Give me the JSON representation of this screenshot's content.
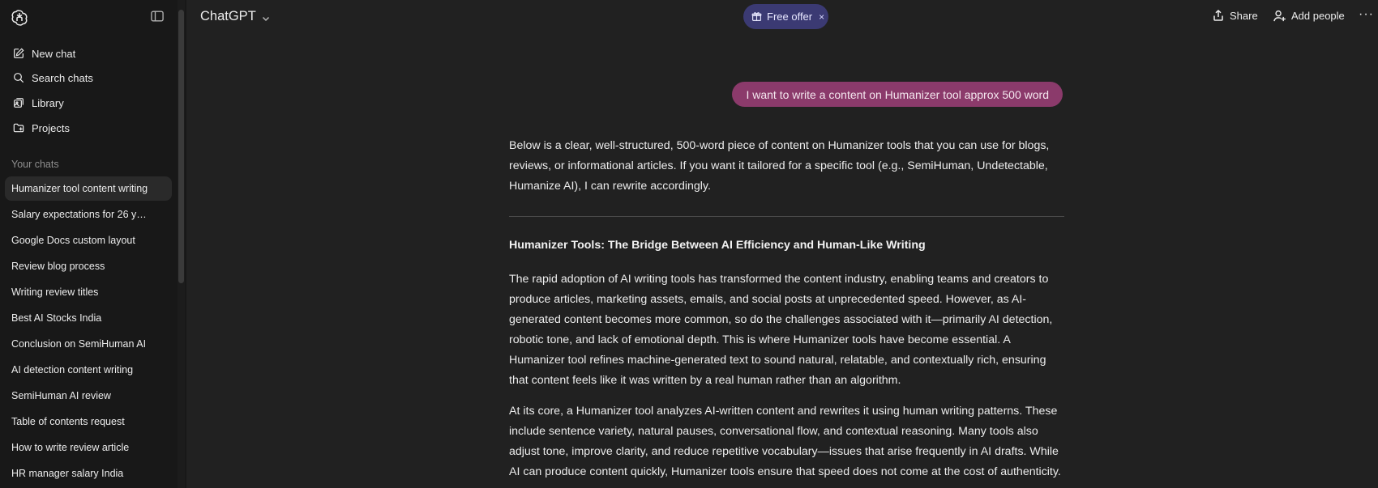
{
  "sidebar": {
    "actions": [
      {
        "label": "New chat",
        "icon": "new-chat-icon"
      },
      {
        "label": "Search chats",
        "icon": "search-icon"
      },
      {
        "label": "Library",
        "icon": "library-icon"
      },
      {
        "label": "Projects",
        "icon": "projects-icon"
      }
    ],
    "section_title": "Your chats",
    "chats": [
      "Humanizer tool content writing",
      "Salary expectations for 26 y…",
      "Google Docs custom layout",
      "Review blog process",
      "Writing review titles",
      "Best AI Stocks India",
      "Conclusion on SemiHuman AI",
      "AI detection content writing",
      "SemiHuman AI review",
      "Table of contents request",
      "How to write review article",
      "HR manager salary India"
    ]
  },
  "header": {
    "model": "ChatGPT",
    "offer_label": "Free offer",
    "offer_close": "×",
    "share_label": "Share",
    "add_people_label": "Add people",
    "more_label": "···"
  },
  "conversation": {
    "user_message": "I want to write a content on Humanizer tool approx 500 word",
    "intro": "Below is a clear, well-structured, 500-word piece of content on Humanizer tools that you can use for blogs, reviews, or informational articles. If you want it tailored for a specific tool (e.g., SemiHuman, Undetectable, Humanize AI), I can rewrite accordingly.",
    "heading": "Humanizer Tools: The Bridge Between AI Efficiency and Human-Like Writing",
    "paragraph1": "The rapid adoption of AI writing tools has transformed the content industry, enabling teams and creators to produce articles, marketing assets, emails, and social posts at unprecedented speed. However, as AI-generated content becomes more common, so do the challenges associated with it—primarily AI detection, robotic tone, and lack of emotional depth. This is where Humanizer tools have become essential. A Humanizer tool refines machine-generated text to sound natural, relatable, and contextually rich, ensuring that content feels like it was written by a real human rather than an algorithm.",
    "paragraph2": "At its core, a Humanizer tool analyzes AI-written content and rewrites it using human writing patterns. These include sentence variety, natural pauses, conversational flow, and contextual reasoning. Many tools also adjust tone, improve clarity, and reduce repetitive vocabulary—issues that arise frequently in AI drafts. While AI can produce content quickly, Humanizer tools ensure that speed does not come at the cost of authenticity."
  },
  "colors": {
    "background": "#212121",
    "sidebar": "#181818",
    "user_bubble": "#8b3a6b",
    "offer_pill": "#3b3a73"
  }
}
